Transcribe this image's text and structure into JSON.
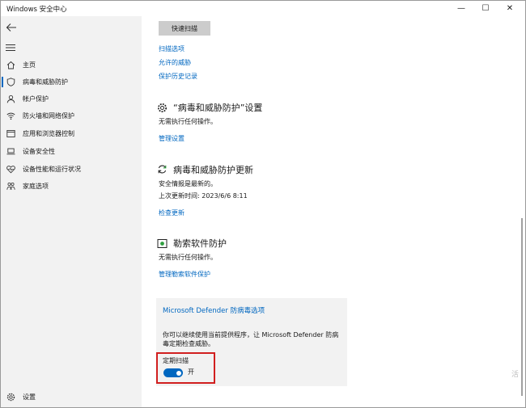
{
  "window": {
    "title": "Windows 安全中心",
    "minimize_glyph": "—",
    "maximize_glyph": "☐",
    "close_glyph": "✕"
  },
  "sidebar": {
    "items": [
      {
        "label": "主页",
        "icon": "home-icon",
        "active": false
      },
      {
        "label": "病毒和威胁防护",
        "icon": "shield-icon",
        "active": true
      },
      {
        "label": "帐户保护",
        "icon": "person-icon",
        "active": false
      },
      {
        "label": "防火墙和网络保护",
        "icon": "wifi-icon",
        "active": false
      },
      {
        "label": "应用和浏览器控制",
        "icon": "app-browser-icon",
        "active": false
      },
      {
        "label": "设备安全性",
        "icon": "laptop-icon",
        "active": false
      },
      {
        "label": "设备性能和运行状况",
        "icon": "heart-icon",
        "active": false
      },
      {
        "label": "家庭选项",
        "icon": "family-icon",
        "active": false
      }
    ],
    "settings_label": "设置"
  },
  "main": {
    "quick_scan_label": "快速扫描",
    "links": [
      "扫描选项",
      "允许的威胁",
      "保护历史记录"
    ],
    "settings_section": {
      "title": "“病毒和威胁防护”设置",
      "status": "无需执行任何操作。",
      "link": "管理设置"
    },
    "updates_section": {
      "title": "病毒和威胁防护更新",
      "status": "安全情报是最新的。",
      "last_update": "上次更新时间: 2023/6/6 8:11",
      "link": "检查更新"
    },
    "ransomware_section": {
      "title": "勒索软件防护",
      "status": "无需执行任何操作。",
      "link": "管理勒索软件保护"
    },
    "defender_card": {
      "title": "Microsoft Defender 防病毒选项",
      "description": "你可以继续使用当前提供程序，让 Microsoft Defender 防病毒定期检查威胁。",
      "periodic_scan_label": "定期扫描",
      "toggle_state": "开",
      "toggle_on": true
    }
  },
  "colors": {
    "accent": "#0067c0",
    "sidebar_bg": "#f2f2f2",
    "highlight_border": "#d11f1f"
  },
  "watermark_text": "活"
}
